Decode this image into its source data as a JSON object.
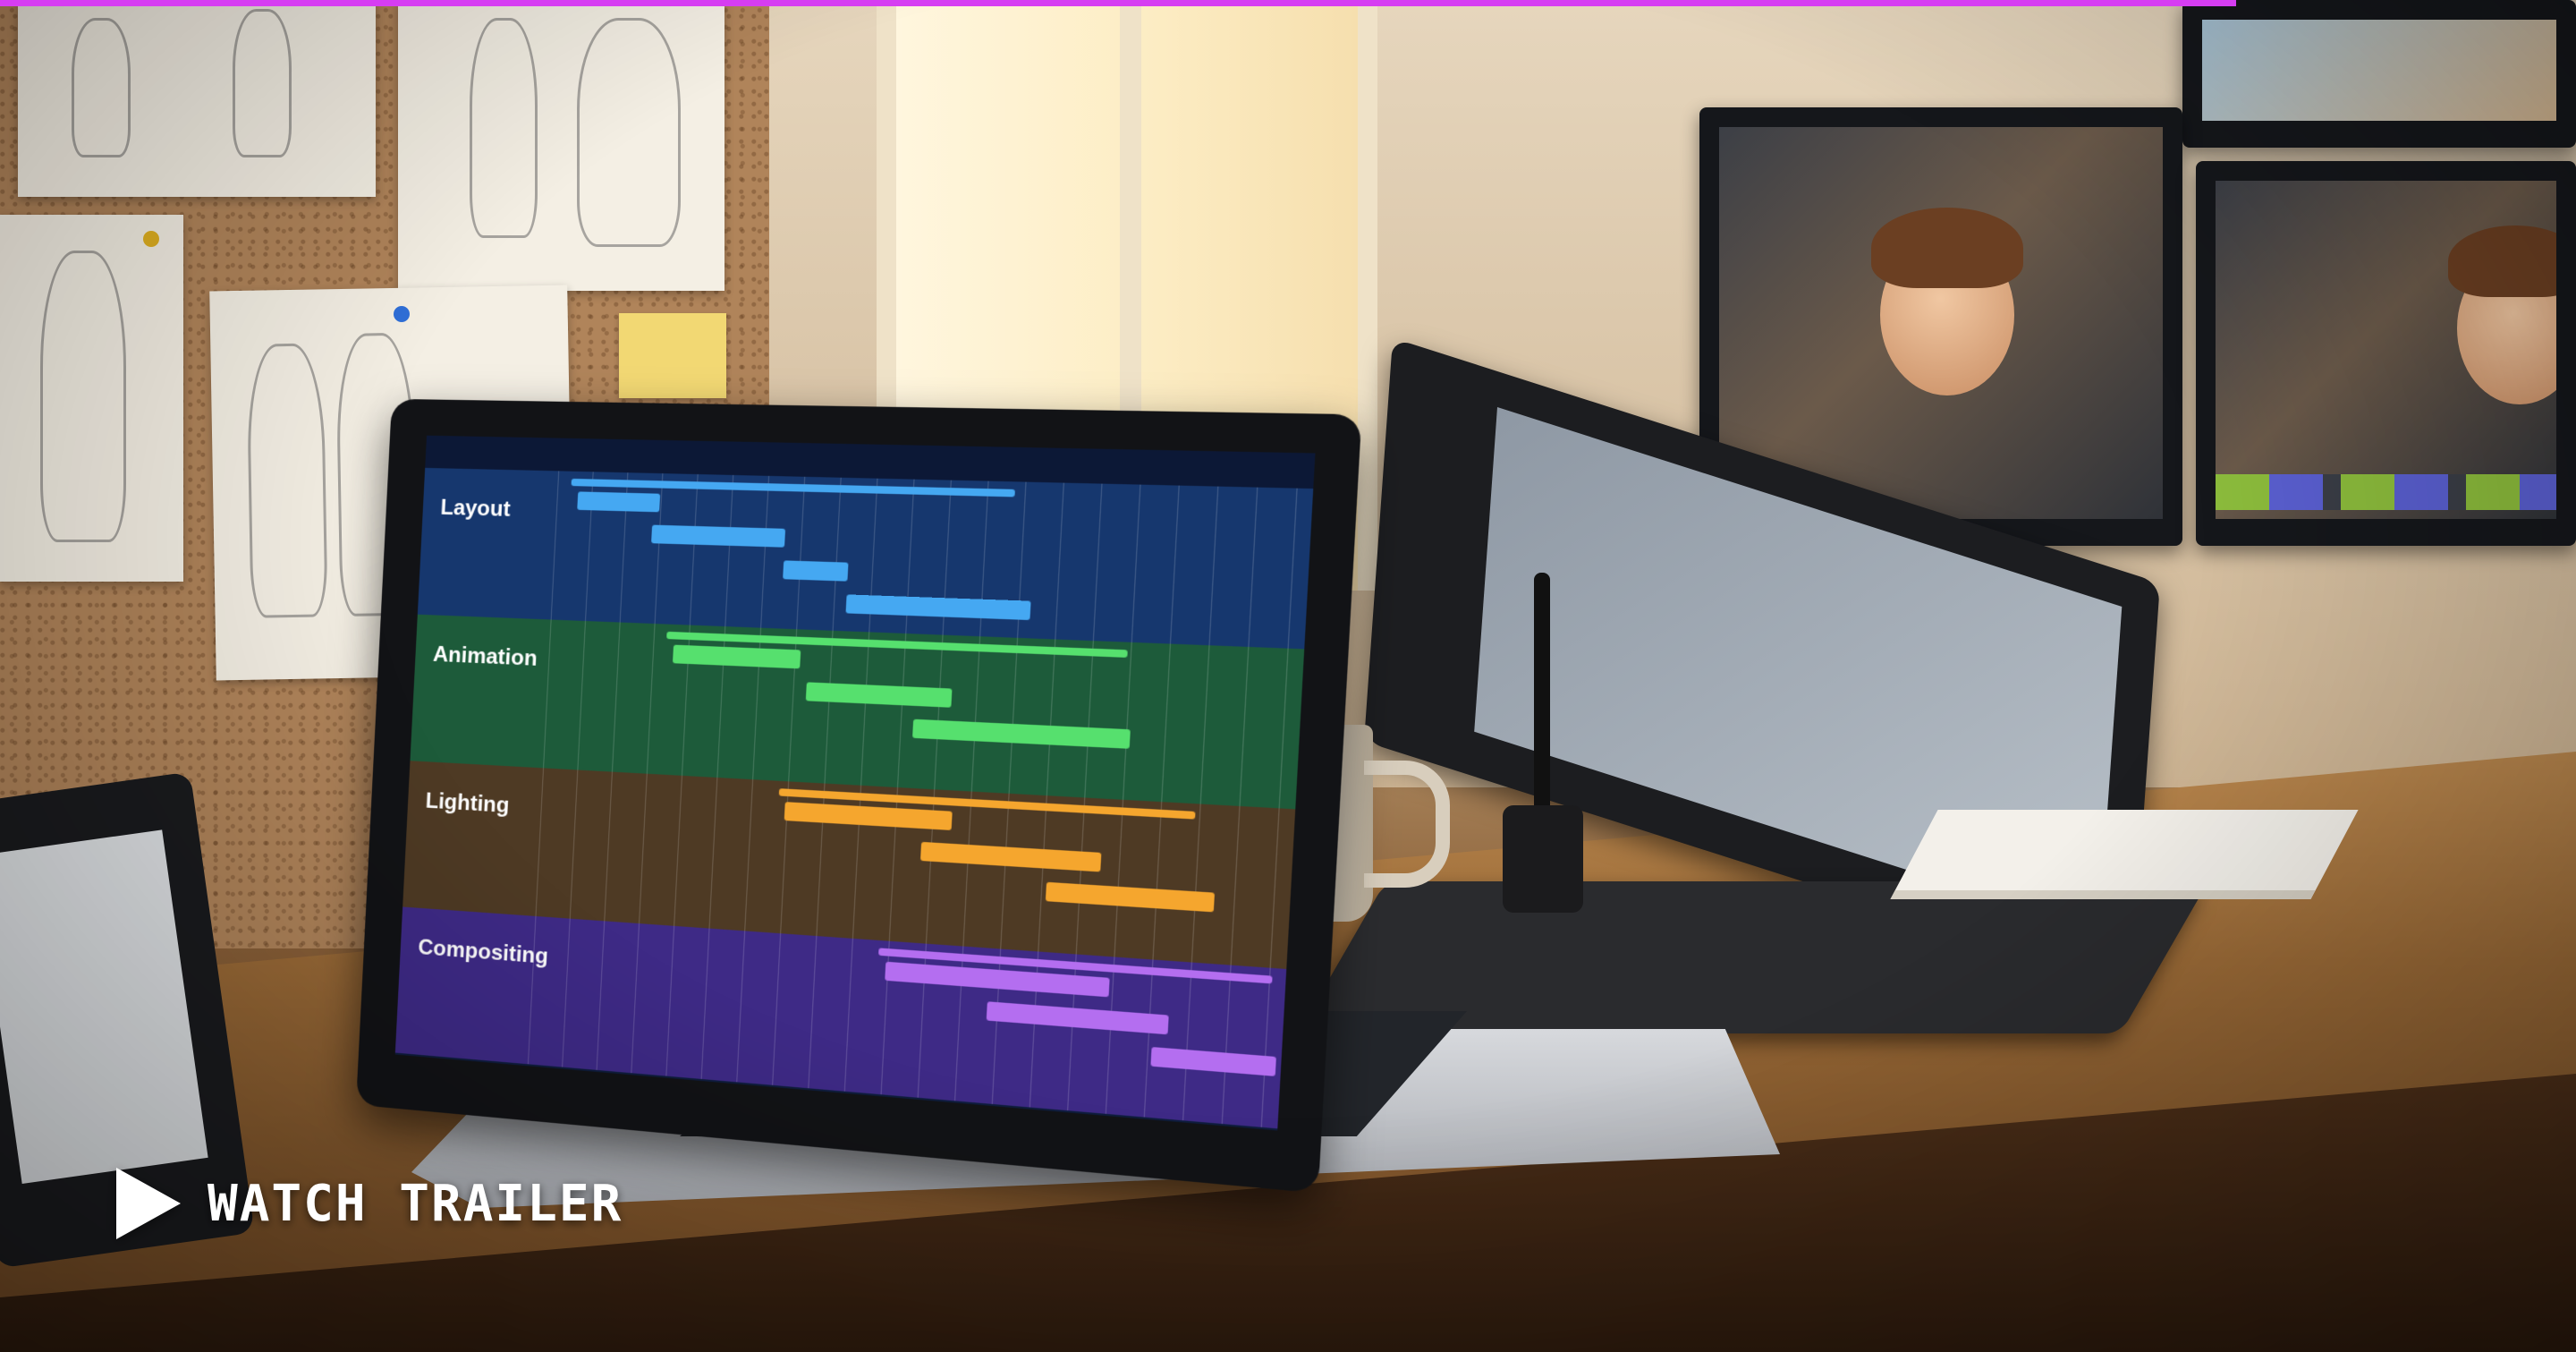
{
  "video": {
    "cta_label": "WATCH TRAILER",
    "play_icon": "play-icon",
    "progress_fraction": 0.868,
    "progress_color": "#d63df2"
  },
  "laptop_screen": {
    "tracks": [
      {
        "label": "Layout",
        "band_color": "#16376e",
        "bar_color": "#45a8f2"
      },
      {
        "label": "Animation",
        "band_color": "#1d5b3a",
        "bar_color": "#56e06e"
      },
      {
        "label": "Lighting",
        "band_color": "#4e3a24",
        "bar_color": "#f5a62e"
      },
      {
        "label": "Compositing",
        "band_color": "#3e2a86",
        "bar_color": "#b46ef0"
      }
    ]
  }
}
